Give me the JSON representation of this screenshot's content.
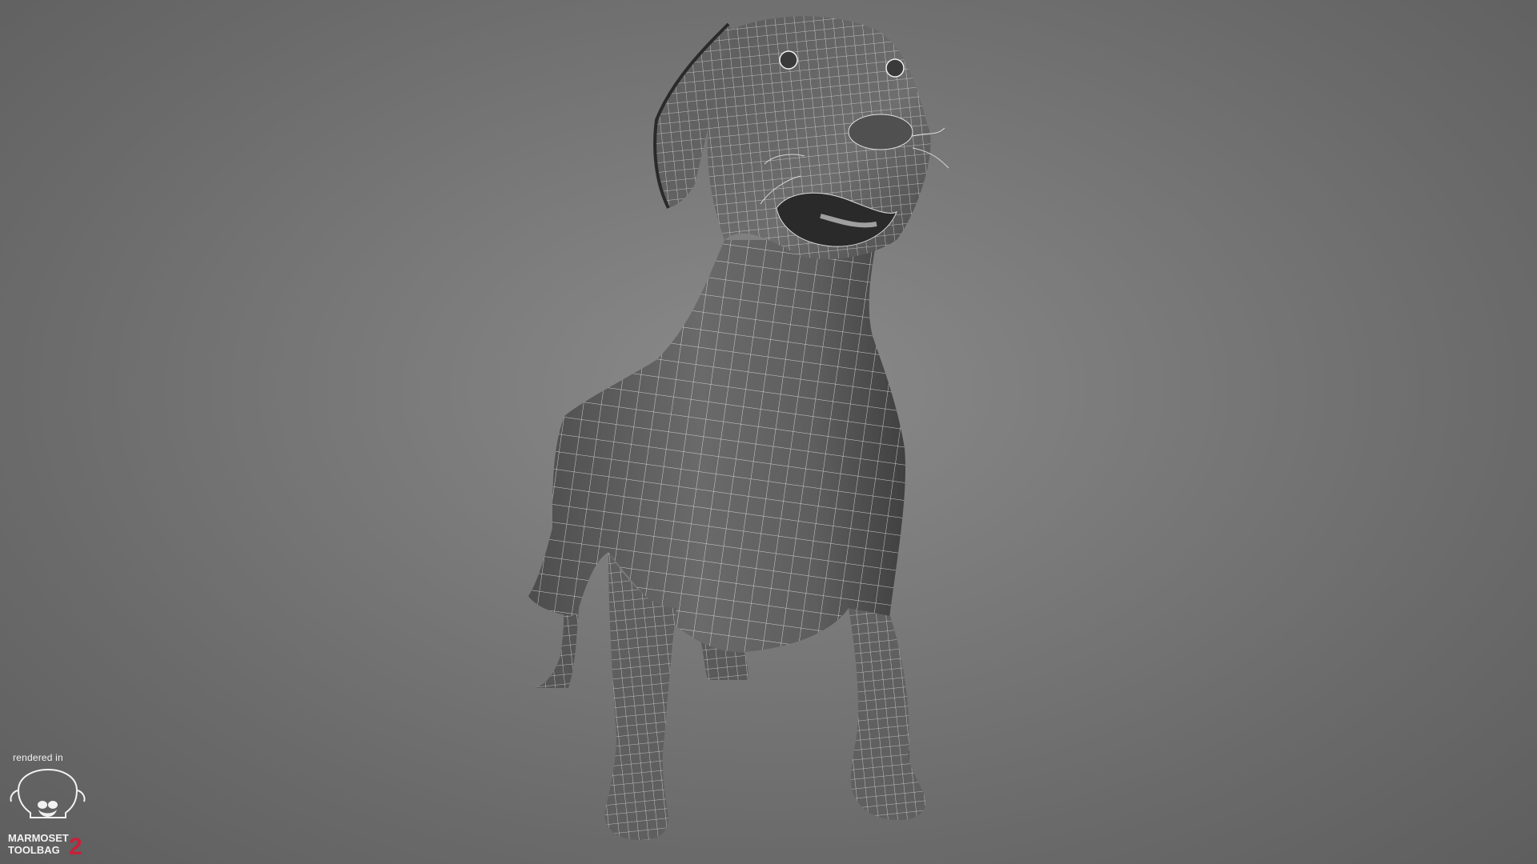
{
  "watermark": {
    "caption": "rendered in",
    "brand_line1": "MARMOSET",
    "brand_line2": "TOOLBAG",
    "version": "2",
    "accent_color": "#c8203a"
  },
  "render": {
    "background_color": "#7a7a7a",
    "mesh_fill_color": "#5a5a5a",
    "wire_color": "#e6e6e6",
    "subject_icon": "dog-wireframe-model"
  }
}
